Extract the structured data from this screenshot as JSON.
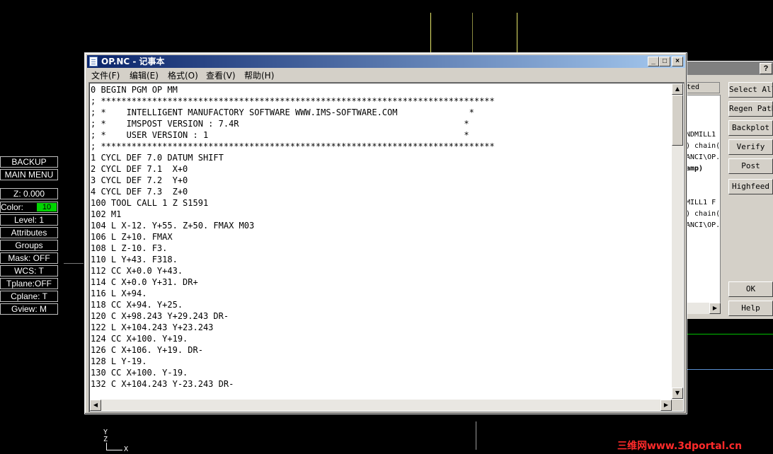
{
  "cad_menu": {
    "backup": "BACKUP",
    "main_menu": "MAIN MENU",
    "z": "Z:  0.000",
    "color_label": "Color:",
    "color_value": "10",
    "level": "Level:  1",
    "attributes": "Attributes",
    "groups": "Groups",
    "mask": "Mask:  OFF",
    "wcs": "WCS:   T",
    "tplane": "Tplane:OFF",
    "cplane": "Cplane:  T",
    "gview": "Gview:   M"
  },
  "ops_dialog": {
    "help_q": "?",
    "list_header": "ted",
    "list_lines": [
      "",
      "",
      "",
      "NDMILL1",
      ") chain(",
      "ANCI\\OP.",
      "amp)",
      "",
      "",
      "MILL1 F",
      ") chain(",
      "ANCI\\OP."
    ],
    "buttons": {
      "select_all": "Select All",
      "regen_path": "Regen Path",
      "backplot": "Backplot",
      "verify": "Verify",
      "post": "Post",
      "highfeed": "Highfeed",
      "ok": "OK",
      "help": "Help"
    }
  },
  "notepad": {
    "title": "OP.NC - 记事本",
    "minimize": "_",
    "maximize": "□",
    "close": "×",
    "menu": {
      "file": "文件(F)",
      "edit": "编辑(E)",
      "format": "格式(O)",
      "view": "查看(V)",
      "help": "帮助(H)"
    },
    "lines": [
      "0 BEGIN PGM OP MM",
      "; *****************************************************************************",
      "; *    INTELLIGENT MANUFACTORY SOFTWARE WWW.IMS-SOFTWARE.COM              *",
      "; *    IMSPOST VERSION : 7.4R                                            *",
      "; *    USER VERSION : 1                                                  *",
      "; *****************************************************************************",
      "1 CYCL DEF 7.0 DATUM SHIFT",
      "2 CYCL DEF 7.1  X+0",
      "3 CYCL DEF 7.2  Y+0",
      "4 CYCL DEF 7.3  Z+0",
      "100 TOOL CALL 1 Z S1591",
      "102 M1",
      "104 L X-12. Y+55. Z+50. FMAX M03",
      "106 L Z+10. FMAX",
      "108 L Z-10. F3.",
      "110 L Y+43. F318.",
      "112 CC X+0.0 Y+43.",
      "114 C X+0.0 Y+31. DR+",
      "116 L X+94.",
      "118 CC X+94. Y+25.",
      "120 C X+98.243 Y+29.243 DR-",
      "122 L X+104.243 Y+23.243",
      "124 CC X+100. Y+19.",
      "126 C X+106. Y+19. DR-",
      "128 L Y-19.",
      "130 CC X+100. Y-19.",
      "132 C X+104.243 Y-23.243 DR-"
    ]
  },
  "axis": {
    "y": "Y",
    "z": "Z",
    "x": "X"
  },
  "watermark": "三维网www.3dportal.cn",
  "colors": {
    "titlebar": "#0a246a",
    "color_swatch": "#00d400",
    "watermark": "#ff2a2a"
  }
}
